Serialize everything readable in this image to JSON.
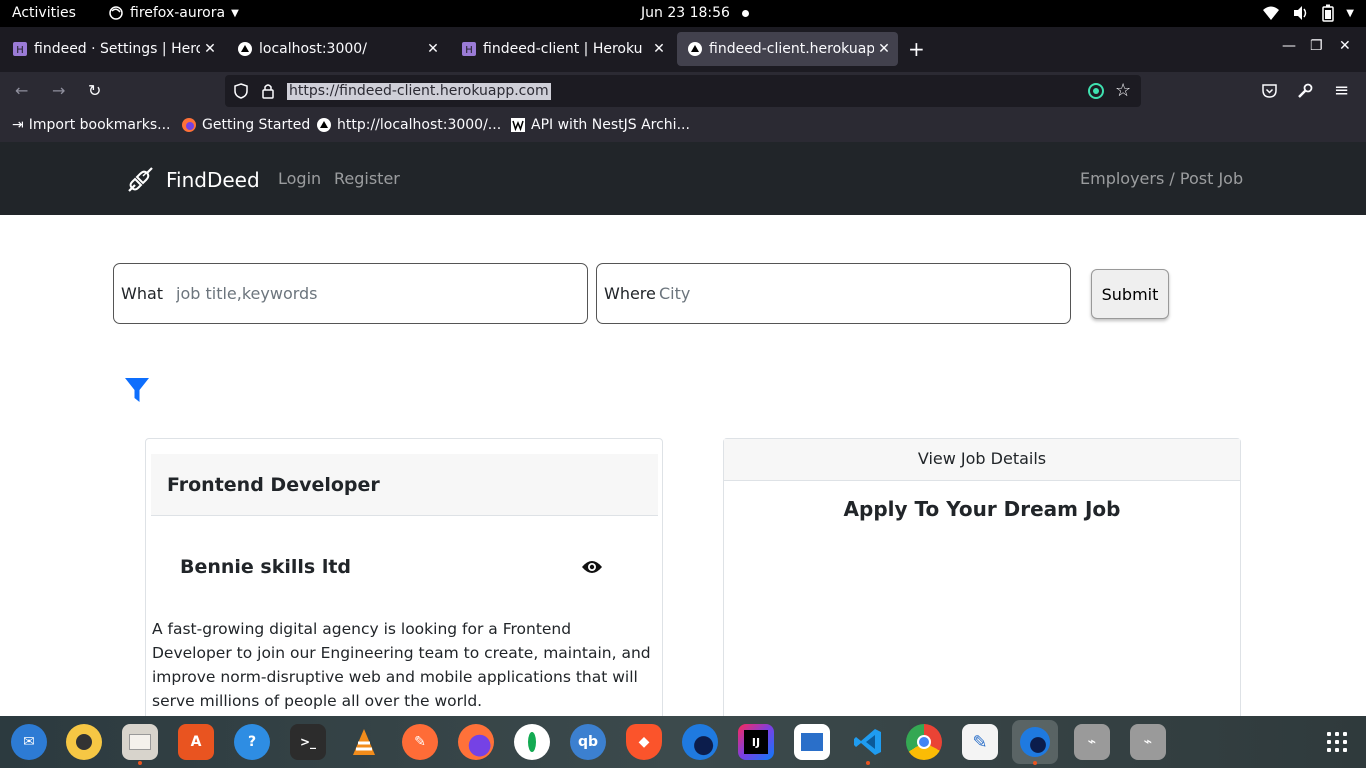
{
  "system": {
    "activities": "Activities",
    "app_name": "firefox-aurora",
    "clock": "Jun 23  18:56"
  },
  "tabs": [
    {
      "title": "findeed · Settings | Heroku",
      "icon": "heroku-icon",
      "active": false
    },
    {
      "title": "localhost:3000/",
      "icon": "nextjs-icon",
      "active": false
    },
    {
      "title": "findeed-client | Heroku",
      "icon": "heroku-icon",
      "active": false
    },
    {
      "title": "findeed-client.herokuapp.com",
      "icon": "nextjs-icon",
      "active": true
    }
  ],
  "browser": {
    "url": "https://findeed-client.herokuapp.com"
  },
  "bookmarks": [
    {
      "label": "Import bookmarks...",
      "icon": "import-icon"
    },
    {
      "label": "Getting Started",
      "icon": "firefox-icon"
    },
    {
      "label": "http://localhost:3000/...",
      "icon": "nextjs-icon"
    },
    {
      "label": "API with NestJS Archi...",
      "icon": "wanago-icon"
    }
  ],
  "site": {
    "brand": "FindDeed",
    "login": "Login",
    "register": "Register",
    "employers": "Employers / Post Job"
  },
  "search": {
    "what_label": "What",
    "what_placeholder": "job title,keywords",
    "where_label": "Where",
    "where_placeholder": "City",
    "submit": "Submit"
  },
  "job": {
    "title": "Frontend Developer",
    "company": "Bennie skills ltd",
    "description": "A fast-growing digital agency is looking for a Frontend Developer to join our Engineering team to create, maintain, and improve norm-disruptive web and mobile applications that will serve millions of people all over the world."
  },
  "details": {
    "header": "View Job Details",
    "heading": "Apply To Your Dream Job"
  },
  "dock": [
    "thunderbird-icon",
    "rhythmbox-icon",
    "files-icon",
    "software-icon",
    "help-icon",
    "terminal-icon",
    "vlc-icon",
    "postman-icon",
    "firefox-icon",
    "mongodb-compass-icon",
    "qbittorrent-icon",
    "brave-icon",
    "firefox-developer-icon",
    "intellij-icon",
    "libreoffice-writer-icon",
    "vscode-icon",
    "chrome-icon",
    "text-editor-icon",
    "firefox-aurora-icon",
    "usb-drive-icon",
    "usb-drive-icon"
  ]
}
